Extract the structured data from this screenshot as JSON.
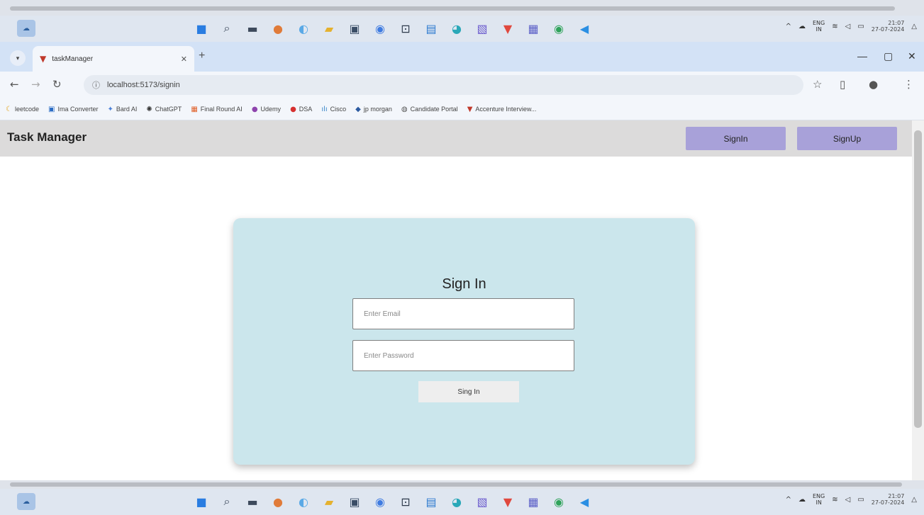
{
  "taskbar": {
    "icons": [
      {
        "name": "windows-start-icon",
        "glyph": "■",
        "color": "#2a7de1"
      },
      {
        "name": "search-icon",
        "glyph": "⌕",
        "color": "#3d4a5c"
      },
      {
        "name": "task-view-icon",
        "glyph": "▬",
        "color": "#3d4a5c"
      },
      {
        "name": "widgets-icon",
        "glyph": "●",
        "color": "#e07b39"
      },
      {
        "name": "copilot-icon",
        "glyph": "◐",
        "color": "#5aa9e6"
      },
      {
        "name": "file-explorer-icon",
        "glyph": "▰",
        "color": "#e5b12e"
      },
      {
        "name": "store-icon",
        "glyph": "▣",
        "color": "#3a4d66"
      },
      {
        "name": "chrome-icon",
        "glyph": "◉",
        "color": "#3f7be0"
      },
      {
        "name": "terminal-icon",
        "glyph": "⊡",
        "color": "#2d3a4b"
      },
      {
        "name": "mail-icon",
        "glyph": "▤",
        "color": "#2e7bcf"
      },
      {
        "name": "edge-icon",
        "glyph": "◕",
        "color": "#2aa8b8"
      },
      {
        "name": "photos-icon",
        "glyph": "▧",
        "color": "#6a5acd"
      },
      {
        "name": "brave-icon",
        "glyph": "▼",
        "color": "#e0483d"
      },
      {
        "name": "teams-icon",
        "glyph": "▦",
        "color": "#5b5fc7"
      },
      {
        "name": "chrome-dev-icon",
        "glyph": "◉",
        "color": "#2fa35a"
      },
      {
        "name": "vscode-icon",
        "glyph": "◀",
        "color": "#2b8fe3"
      }
    ],
    "tray": {
      "lang_top": "ENG",
      "lang_bottom": "IN",
      "time": "21:07",
      "date": "27-07-2024"
    }
  },
  "browser": {
    "tab_title": "taskManager",
    "url": "localhost:5173/signin",
    "bookmarks": [
      {
        "label": "leetcode",
        "icon": "code-icon",
        "glyph": "☾",
        "color": "#e4a41c"
      },
      {
        "label": "Ima Converter",
        "icon": "image-icon",
        "glyph": "▣",
        "color": "#2b6cc4"
      },
      {
        "label": "Bard AI",
        "icon": "sparkle-icon",
        "glyph": "✦",
        "color": "#4a7fd8"
      },
      {
        "label": "ChatGPT",
        "icon": "chatgpt-icon",
        "glyph": "✺",
        "color": "#333333"
      },
      {
        "label": "Final Round AI",
        "icon": "grid-icon",
        "glyph": "▦",
        "color": "#e0602a"
      },
      {
        "label": "Udemy",
        "icon": "udemy-icon",
        "glyph": "●",
        "color": "#8e44ad"
      },
      {
        "label": "DSA",
        "icon": "dsa-icon",
        "glyph": "●",
        "color": "#d63030"
      },
      {
        "label": "Cisco",
        "icon": "cisco-icon",
        "glyph": "ılı",
        "color": "#3a87c8"
      },
      {
        "label": "jp morgan",
        "icon": "jpmorgan-icon",
        "glyph": "◆",
        "color": "#2c5aa0"
      },
      {
        "label": "Candidate Portal",
        "icon": "portal-icon",
        "glyph": "◍",
        "color": "#555555"
      },
      {
        "label": "Accenture Interview...",
        "icon": "accenture-icon",
        "glyph": "▼",
        "color": "#c0392b"
      }
    ]
  },
  "app": {
    "title": "Task Manager",
    "signin_button": "SignIn",
    "signup_button": "SignUp",
    "form": {
      "heading": "Sign In",
      "email_placeholder": "Enter Email",
      "password_placeholder": "Enter Password",
      "submit_label": "Sing In"
    },
    "colors": {
      "header_bg": "#dcdbdb",
      "header_button_bg": "#a8a1d9",
      "card_bg": "#cbe6ec"
    }
  }
}
